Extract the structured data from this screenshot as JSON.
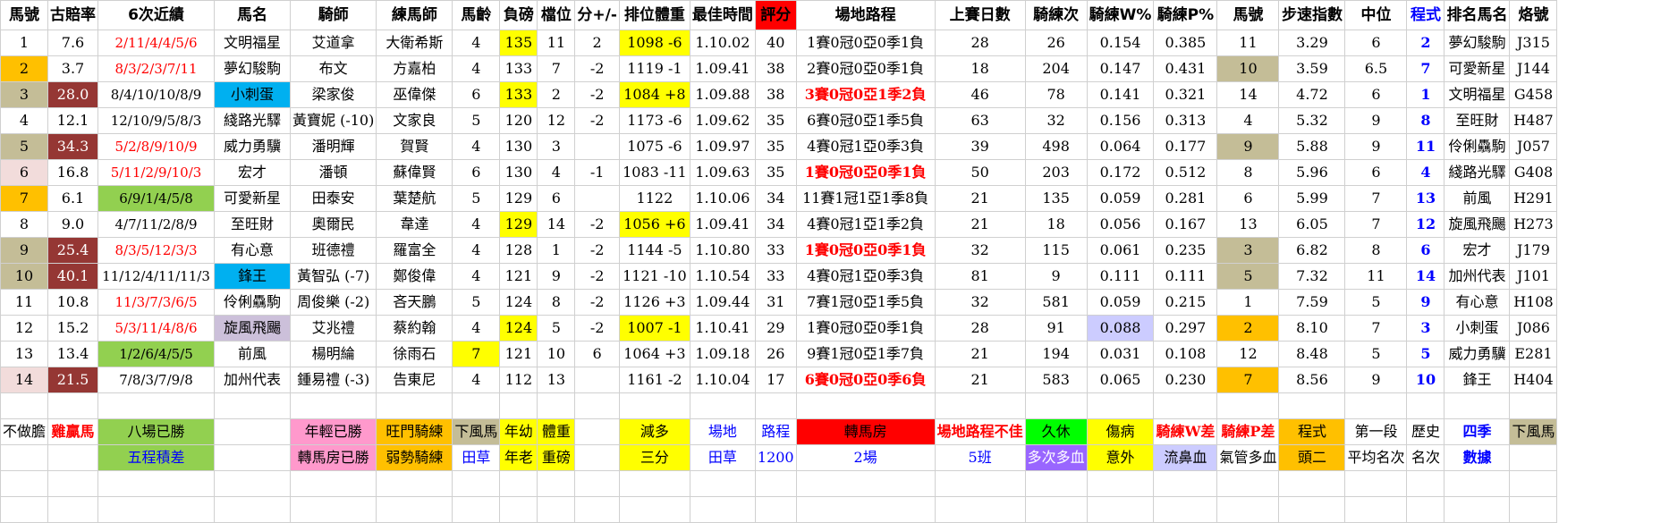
{
  "headers": [
    "馬號",
    "古賠率",
    "6次近績",
    "馬名",
    "騎師",
    "練馬師",
    "馬齡",
    "負磅",
    "檔位",
    "分+/-",
    "排位體重",
    "最佳時間",
    "評分",
    "場地路程",
    "上賽日數",
    "騎練次",
    "騎練W%",
    "騎練P%",
    "馬號",
    "步速指數",
    "中位",
    "程式",
    "排名馬名",
    "烙號"
  ],
  "rows": [
    [
      "1",
      "7.6",
      "2/11/4/4/5/6",
      "文明福星",
      "艾道拿",
      "大衛希斯",
      "4",
      "135",
      "11",
      "2",
      "1098 -6",
      "1.10.02",
      "40",
      "1賽0冠0亞0季1負",
      "28",
      "26",
      "0.154",
      "0.385",
      "11",
      "3.29",
      "6",
      "2",
      "夢幻駿駒",
      "J315"
    ],
    [
      "2",
      "3.7",
      "8/3/2/3/7/11",
      "夢幻駿駒",
      "布文",
      "方嘉柏",
      "4",
      "133",
      "7",
      "-2",
      "1119 -1",
      "1.09.41",
      "38",
      "2賽0冠0亞0季1負",
      "18",
      "204",
      "0.147",
      "0.431",
      "10",
      "3.59",
      "6.5",
      "7",
      "可愛新星",
      "J144"
    ],
    [
      "3",
      "28.0",
      "8/4/10/10/8/9",
      "小刺蛋",
      "梁家俊",
      "巫偉傑",
      "6",
      "133",
      "2",
      "-2",
      "1084 +8",
      "1.09.88",
      "38",
      "3賽0冠0亞1季2負",
      "46",
      "78",
      "0.141",
      "0.321",
      "14",
      "4.72",
      "6",
      "1",
      "文明福星",
      "G458"
    ],
    [
      "4",
      "12.1",
      "12/10/9/5/8/3",
      "綫路光驛",
      "黃寶妮 (-10)",
      "文家良",
      "5",
      "120",
      "12",
      "-2",
      "1173 -6",
      "1.09.62",
      "35",
      "6賽0冠0亞1季5負",
      "63",
      "32",
      "0.156",
      "0.313",
      "4",
      "5.32",
      "9",
      "8",
      "至旺財",
      "H487"
    ],
    [
      "5",
      "34.3",
      "5/2/8/9/10/9",
      "威力勇驥",
      "潘明輝",
      "賀賢",
      "4",
      "130",
      "3",
      "",
      "1075 -6",
      "1.09.97",
      "35",
      "4賽0冠1亞0季3負",
      "39",
      "498",
      "0.064",
      "0.177",
      "9",
      "5.88",
      "9",
      "11",
      "伶俐驫駒",
      "J057"
    ],
    [
      "6",
      "16.8",
      "5/11/2/9/10/3",
      "宏才",
      "潘頓",
      "蘇偉賢",
      "6",
      "130",
      "4",
      "-1",
      "1083 -11",
      "1.09.63",
      "35",
      "1賽0冠0亞0季1負",
      "50",
      "203",
      "0.172",
      "0.512",
      "8",
      "5.96",
      "6",
      "4",
      "綫路光驛",
      "G408"
    ],
    [
      "7",
      "6.1",
      "6/9/1/4/5/8",
      "可愛新星",
      "田泰安",
      "葉楚航",
      "5",
      "129",
      "6",
      "",
      "1122",
      "1.10.06",
      "34",
      "11賽1冠1亞1季8負",
      "21",
      "135",
      "0.059",
      "0.281",
      "6",
      "5.99",
      "7",
      "13",
      "前風",
      "H291"
    ],
    [
      "8",
      "9.0",
      "4/7/11/2/8/9",
      "至旺財",
      "奧爾民",
      "韋達",
      "4",
      "129",
      "14",
      "-2",
      "1056 +6",
      "1.09.41",
      "34",
      "4賽0冠1亞1季2負",
      "21",
      "18",
      "0.056",
      "0.167",
      "13",
      "6.05",
      "7",
      "12",
      "旋風飛颺",
      "H273"
    ],
    [
      "9",
      "25.4",
      "8/3/5/12/3/3",
      "有心意",
      "班德禮",
      "羅富全",
      "4",
      "128",
      "1",
      "-2",
      "1144 -5",
      "1.10.80",
      "33",
      "1賽0冠0亞0季1負",
      "32",
      "115",
      "0.061",
      "0.235",
      "3",
      "6.82",
      "8",
      "6",
      "宏才",
      "J179"
    ],
    [
      "10",
      "40.1",
      "11/12/4/11/11/3",
      "鋒王",
      "黃智弘 (-7)",
      "鄭俊偉",
      "4",
      "121",
      "9",
      "-2",
      "1121 -10",
      "1.10.54",
      "33",
      "4賽0冠1亞0季3負",
      "81",
      "9",
      "0.111",
      "0.111",
      "5",
      "7.32",
      "11",
      "14",
      "加州代表",
      "J101"
    ],
    [
      "11",
      "10.8",
      "11/3/7/3/6/5",
      "伶俐驫駒",
      "周俊樂 (-2)",
      "吝天鵬",
      "5",
      "124",
      "8",
      "-2",
      "1126 +3",
      "1.09.44",
      "31",
      "7賽1冠0亞1季5負",
      "32",
      "581",
      "0.059",
      "0.215",
      "1",
      "7.59",
      "5",
      "9",
      "有心意",
      "H108"
    ],
    [
      "12",
      "15.2",
      "5/3/11/4/8/6",
      "旋風飛颺",
      "艾兆禮",
      "蔡約翰",
      "4",
      "124",
      "5",
      "-2",
      "1007 -1",
      "1.10.41",
      "29",
      "1賽0冠0亞0季1負",
      "28",
      "91",
      "0.088",
      "0.297",
      "2",
      "8.10",
      "7",
      "3",
      "小刺蛋",
      "J086"
    ],
    [
      "13",
      "13.4",
      "1/2/6/4/5/5",
      "前風",
      "楊明綸",
      "徐雨石",
      "7",
      "121",
      "10",
      "6",
      "1064 +3",
      "1.09.18",
      "26",
      "9賽1冠0亞1季7負",
      "21",
      "194",
      "0.031",
      "0.108",
      "12",
      "8.48",
      "5",
      "5",
      "威力勇驥",
      "E281"
    ],
    [
      "14",
      "21.5",
      "7/8/3/7/9/8",
      "加州代表",
      "鍾易禮 (-3)",
      "告東尼",
      "4",
      "112",
      "13",
      "",
      "1161 -2",
      "1.10.04",
      "17",
      "6賽0冠0亞0季6負",
      "21",
      "583",
      "0.065",
      "0.230",
      "7",
      "8.56",
      "9",
      "10",
      "鋒王",
      "H404"
    ]
  ],
  "legend1": [
    "不做膽",
    "雞贏馬",
    "八場已勝",
    "",
    "年輕已勝",
    "旺門騎練",
    "下風馬",
    "年幼",
    "體重",
    "",
    "減多",
    "場地",
    "",
    "路程",
    "轉馬房",
    "場地路程不佳",
    "",
    "久休",
    "傷病",
    "騎練W差",
    "騎練P差",
    "程式",
    "第一段",
    "歷史",
    "四季",
    "下風馬"
  ],
  "legend2": [
    "",
    "",
    "五程積差",
    "",
    "轉馬房已勝",
    "弱勢騎練",
    "田草",
    "年老",
    "重磅",
    "",
    "三分",
    "田草",
    "",
    "1200",
    "2場",
    "5班",
    "",
    "多次多血",
    "意外",
    "流鼻血",
    "氣管多血",
    "頭二",
    "平均名次",
    "名次",
    "數據",
    ""
  ]
}
